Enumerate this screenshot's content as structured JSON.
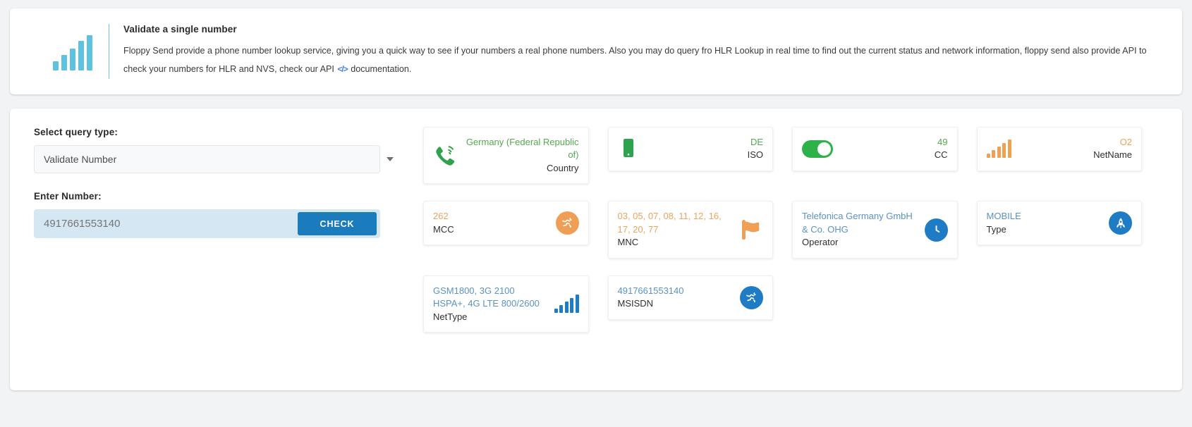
{
  "info": {
    "icon": "bar-chart-icon",
    "title": "Validate a single number",
    "body_part1": "Floppy Send provide a phone number lookup service, giving you a quick way to see if your numbers a real phone numbers. Also you may do query fro HLR Lookup in real time to find out the current status and network information, floppy send also provide API to check your numbers for HLR and NVS, check our API",
    "code_icon": "</>",
    "body_part2": "documentation."
  },
  "form": {
    "query_type_label": "Select query type:",
    "query_type_value": "Validate Number",
    "query_type_options": [
      "Validate Number"
    ],
    "caret_icon": "chevron-down-icon",
    "number_label": "Enter Number:",
    "number_value": "4917661553140",
    "number_placeholder": "4917661553140",
    "check_button": "CHECK"
  },
  "results": [
    {
      "key": "Country",
      "value": "Germany (Federal Republic of)",
      "align": "right",
      "color": "green",
      "icon": "phone-waves-icon"
    },
    {
      "key": "ISO",
      "value": "DE",
      "align": "right",
      "color": "green",
      "icon": "mobile-phone-icon"
    },
    {
      "key": "CC",
      "value": "49",
      "align": "right",
      "color": "green",
      "icon": "toggle-on-icon"
    },
    {
      "key": "NetName",
      "value": "O2",
      "align": "right",
      "color": "orange",
      "icon": "signal-bars-icon"
    },
    {
      "key": "MCC",
      "value": "262",
      "align": "left",
      "color": "orange",
      "icon": "globe-icon"
    },
    {
      "key": "MNC",
      "value": "03, 05, 07, 08, 11, 12, 16, 17, 20, 77",
      "align": "left",
      "color": "orange",
      "icon": "flag-icon"
    },
    {
      "key": "Operator",
      "value": "Telefonica Germany GmbH & Co. OHG",
      "align": "left",
      "color": "blue",
      "icon": "clock-icon"
    },
    {
      "key": "Type",
      "value": "MOBILE",
      "align": "left",
      "color": "blue",
      "icon": "rocket-icon"
    },
    {
      "key": "NetType",
      "value": "GSM1800, 3G 2100 HSPA+, 4G LTE 800/2600",
      "align": "left",
      "color": "blue",
      "icon": "signal-bars-icon"
    },
    {
      "key": "MSISDN",
      "value": "4917661553140",
      "align": "left",
      "color": "blue",
      "icon": "globe-icon"
    }
  ],
  "colors": {
    "accent_blue": "#1a7cbc",
    "green": "#54a84f",
    "orange": "#eda45c",
    "blue_text": "#5b92c4",
    "info_icon": "#5dc2e0",
    "page_bg": "#f2f3f5",
    "input_bg": "#d5e7f2"
  }
}
